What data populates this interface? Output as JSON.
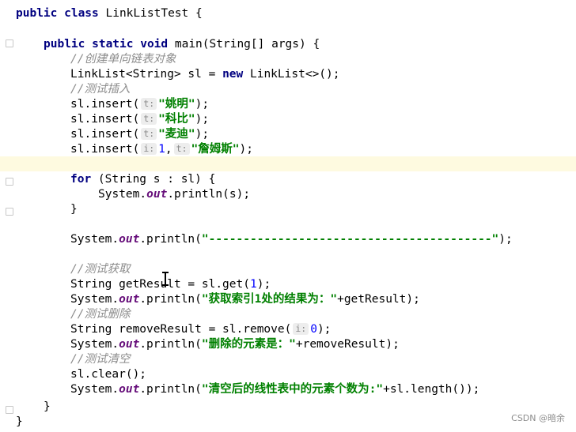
{
  "code": {
    "l1": {
      "kw": "public class",
      "rest": " LinkListTest {"
    },
    "l2": {
      "kw": "public static void",
      "rest": " main(String[] args) {"
    },
    "c_create": "//创建单向链表对象",
    "l3": {
      "pre": "LinkList<String> sl = ",
      "kw": "new",
      "post": " LinkList<>();"
    },
    "c_insert": "//测试插入",
    "ins1": {
      "call": "sl.insert(",
      "hint": "t:",
      "str": "\"姚明\"",
      "end": ");"
    },
    "ins2": {
      "call": "sl.insert(",
      "hint": "t:",
      "str": "\"科比\"",
      "end": ");"
    },
    "ins3": {
      "call": "sl.insert(",
      "hint": "t:",
      "str": "\"麦迪\"",
      "end": ");"
    },
    "ins4": {
      "call": "sl.insert(",
      "hint_i": "i:",
      "num": "1",
      "comma": ",",
      "hint": "t:",
      "str": "\"詹姆斯\"",
      "end": ");"
    },
    "for": {
      "kw": "for",
      "rest": " (String s : sl) {"
    },
    "sys1": {
      "pre": "System.",
      "fld": "out",
      "post": ".println(s);"
    },
    "close1": "}",
    "sep": {
      "pre": "System.",
      "fld": "out",
      "mid": ".println(",
      "str": "\"-----------------------------------------\"",
      "end": ");"
    },
    "c_get": "//测试获取",
    "get": {
      "pre": "String getResult = sl.get(",
      "num": "1",
      "end": ");"
    },
    "sys2": {
      "pre": "System.",
      "fld": "out",
      "mid": ".println(",
      "str": "\"获取索引1处的结果为：\"",
      "end": "+getResult);"
    },
    "c_del": "//测试删除",
    "rem": {
      "pre": "String removeResult = sl.remove(",
      "hint": "i:",
      "num": "0",
      "end": ");"
    },
    "sys3": {
      "pre": "System.",
      "fld": "out",
      "mid": ".println(",
      "str": "\"删除的元素是：\"",
      "end": "+removeResult);"
    },
    "c_clear": "//测试清空",
    "clear": "sl.clear();",
    "sys4": {
      "pre": "System.",
      "fld": "out",
      "mid": ".println(",
      "str": "\"清空后的线性表中的元素个数为:\"",
      "end": "+sl.length());"
    },
    "close2": "}",
    "close3": "}"
  },
  "watermark": "CSDN @暗余"
}
